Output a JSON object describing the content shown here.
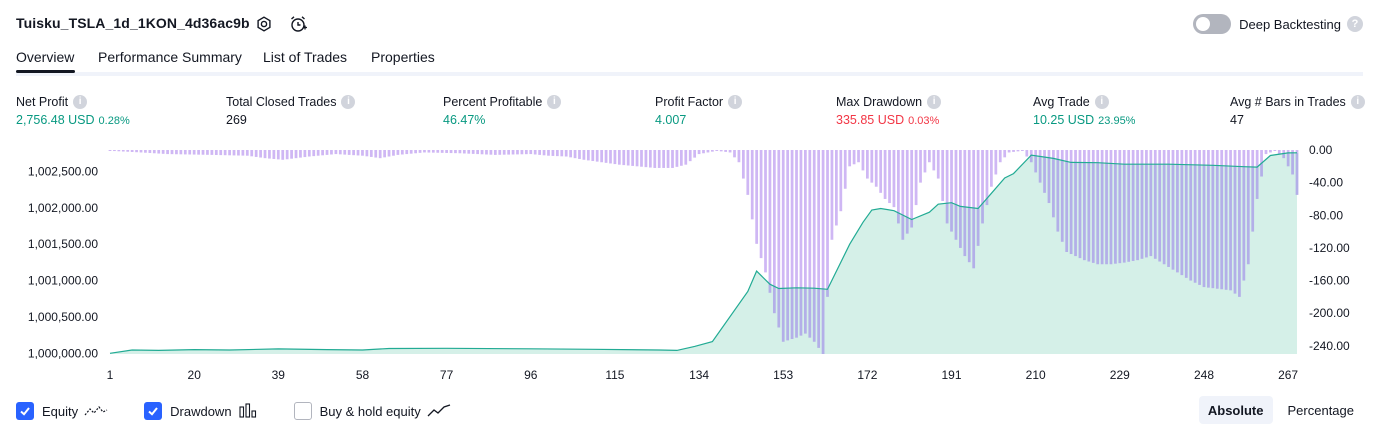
{
  "header": {
    "strategy_name": "Tuisku_TSLA_1d_1KON_4d36ac9b",
    "deep_backtesting_label": "Deep Backtesting"
  },
  "tabs": [
    "Overview",
    "Performance Summary",
    "List of Trades",
    "Properties"
  ],
  "active_tab": 0,
  "stats": [
    {
      "label": "Net Profit",
      "value": "2,756.48 USD",
      "pct": "0.28%",
      "color": "green"
    },
    {
      "label": "Total Closed Trades",
      "value": "269",
      "pct": "",
      "color": "dark"
    },
    {
      "label": "Percent Profitable",
      "value": "46.47%",
      "pct": "",
      "color": "green"
    },
    {
      "label": "Profit Factor",
      "value": "4.007",
      "pct": "",
      "color": "green"
    },
    {
      "label": "Max Drawdown",
      "value": "335.85 USD",
      "pct": "0.03%",
      "color": "red"
    },
    {
      "label": "Avg Trade",
      "value": "10.25 USD",
      "pct": "23.95%",
      "color": "green"
    },
    {
      "label": "Avg # Bars in Trades",
      "value": "47",
      "pct": "",
      "color": "dark"
    }
  ],
  "legend": {
    "equity_label": "Equity",
    "drawdown_label": "Drawdown",
    "buyhold_label": "Buy & hold equity",
    "equity_checked": true,
    "drawdown_checked": true,
    "buyhold_checked": false
  },
  "mode_buttons": {
    "absolute": "Absolute",
    "percentage": "Percentage",
    "active": "absolute"
  },
  "colors": {
    "equity_line": "#22ab94",
    "equity_fill": "#d5f0e8",
    "drawdown_bar": "#cfb7f4",
    "overlap_bar": "#b3afe8",
    "accent": "#2962ff",
    "green": "#089981",
    "red": "#f23645"
  },
  "chart_data": {
    "type": "area",
    "x_ticks": [
      "1",
      "20",
      "39",
      "58",
      "77",
      "96",
      "115",
      "134",
      "153",
      "172",
      "191",
      "210",
      "229",
      "248",
      "267"
    ],
    "left_axis_ticks": [
      "1,000,000.00",
      "1,000,500.00",
      "1,001,000.00",
      "1,001,500.00",
      "1,002,000.00",
      "1,002,500.00"
    ],
    "right_axis_ticks": [
      "0.00",
      "-40.00",
      "-80.00",
      "-120.00",
      "-160.00",
      "-200.00",
      "-240.00"
    ],
    "left_range": [
      999990,
      1002795
    ],
    "right_range": [
      -250,
      0
    ],
    "x_range": [
      1,
      269
    ],
    "equity": [
      [
        1,
        1000000
      ],
      [
        6,
        1000045
      ],
      [
        12,
        1000040
      ],
      [
        20,
        1000050
      ],
      [
        28,
        1000045
      ],
      [
        39,
        1000060
      ],
      [
        50,
        1000050
      ],
      [
        58,
        1000045
      ],
      [
        64,
        1000065
      ],
      [
        77,
        1000068
      ],
      [
        96,
        1000062
      ],
      [
        110,
        1000055
      ],
      [
        125,
        1000045
      ],
      [
        129,
        1000040
      ],
      [
        133,
        1000095
      ],
      [
        137,
        1000160
      ],
      [
        145,
        1000850
      ],
      [
        147,
        1001130
      ],
      [
        150,
        1000950
      ],
      [
        152,
        1000890
      ],
      [
        156,
        1000900
      ],
      [
        160,
        1000895
      ],
      [
        163,
        1000880
      ],
      [
        168,
        1001500
      ],
      [
        171,
        1001800
      ],
      [
        173,
        1001970
      ],
      [
        175,
        1001990
      ],
      [
        178,
        1001960
      ],
      [
        182,
        1001840
      ],
      [
        186,
        1001940
      ],
      [
        188,
        1002050
      ],
      [
        191,
        1002070
      ],
      [
        193,
        1002020
      ],
      [
        197,
        1001990
      ],
      [
        200,
        1002200
      ],
      [
        203,
        1002410
      ],
      [
        205,
        1002470
      ],
      [
        209,
        1002725
      ],
      [
        214,
        1002680
      ],
      [
        218,
        1002625
      ],
      [
        224,
        1002620
      ],
      [
        230,
        1002600
      ],
      [
        240,
        1002600
      ],
      [
        250,
        1002585
      ],
      [
        257,
        1002565
      ],
      [
        260,
        1002560
      ],
      [
        263,
        1002720
      ],
      [
        267,
        1002755
      ],
      [
        269,
        1002756
      ]
    ],
    "drawdown": [
      [
        1,
        -1
      ],
      [
        8,
        -3
      ],
      [
        14,
        -5
      ],
      [
        24,
        -6
      ],
      [
        32,
        -7
      ],
      [
        36,
        -10
      ],
      [
        40,
        -12
      ],
      [
        46,
        -8
      ],
      [
        52,
        -5
      ],
      [
        58,
        -7
      ],
      [
        62,
        -10
      ],
      [
        66,
        -6
      ],
      [
        72,
        -3
      ],
      [
        80,
        -4
      ],
      [
        88,
        -6
      ],
      [
        96,
        -5
      ],
      [
        100,
        -7
      ],
      [
        104,
        -8
      ],
      [
        108,
        -12
      ],
      [
        112,
        -15
      ],
      [
        116,
        -18
      ],
      [
        120,
        -20
      ],
      [
        124,
        -22
      ],
      [
        128,
        -22
      ],
      [
        131,
        -18
      ],
      [
        134,
        -5
      ],
      [
        138,
        -1
      ],
      [
        141,
        -3
      ],
      [
        143,
        -15
      ],
      [
        145,
        -55
      ],
      [
        147,
        -115
      ],
      [
        149,
        -150
      ],
      [
        151,
        -200
      ],
      [
        153,
        -235
      ],
      [
        156,
        -230
      ],
      [
        158,
        -225
      ],
      [
        160,
        -235
      ],
      [
        162,
        -250
      ],
      [
        164,
        -110
      ],
      [
        166,
        -75
      ],
      [
        168,
        -20
      ],
      [
        170,
        -15
      ],
      [
        172,
        -35
      ],
      [
        174,
        -45
      ],
      [
        176,
        -60
      ],
      [
        178,
        -70
      ],
      [
        180,
        -110
      ],
      [
        182,
        -95
      ],
      [
        184,
        -40
      ],
      [
        186,
        -15
      ],
      [
        188,
        -35
      ],
      [
        190,
        -90
      ],
      [
        192,
        -110
      ],
      [
        194,
        -130
      ],
      [
        196,
        -145
      ],
      [
        198,
        -90
      ],
      [
        200,
        -45
      ],
      [
        202,
        -15
      ],
      [
        204,
        -3
      ],
      [
        207,
        -1
      ],
      [
        209,
        -15
      ],
      [
        211,
        -40
      ],
      [
        213,
        -65
      ],
      [
        215,
        -100
      ],
      [
        217,
        -125
      ],
      [
        219,
        -130
      ],
      [
        221,
        -135
      ],
      [
        224,
        -140
      ],
      [
        227,
        -140
      ],
      [
        230,
        -138
      ],
      [
        233,
        -135
      ],
      [
        236,
        -130
      ],
      [
        239,
        -140
      ],
      [
        242,
        -150
      ],
      [
        245,
        -160
      ],
      [
        248,
        -168
      ],
      [
        251,
        -170
      ],
      [
        254,
        -172
      ],
      [
        256,
        -180
      ],
      [
        258,
        -140
      ],
      [
        260,
        -60
      ],
      [
        262,
        -5
      ],
      [
        264,
        -1
      ],
      [
        266,
        -10
      ],
      [
        268,
        -30
      ],
      [
        269,
        -55
      ]
    ]
  }
}
